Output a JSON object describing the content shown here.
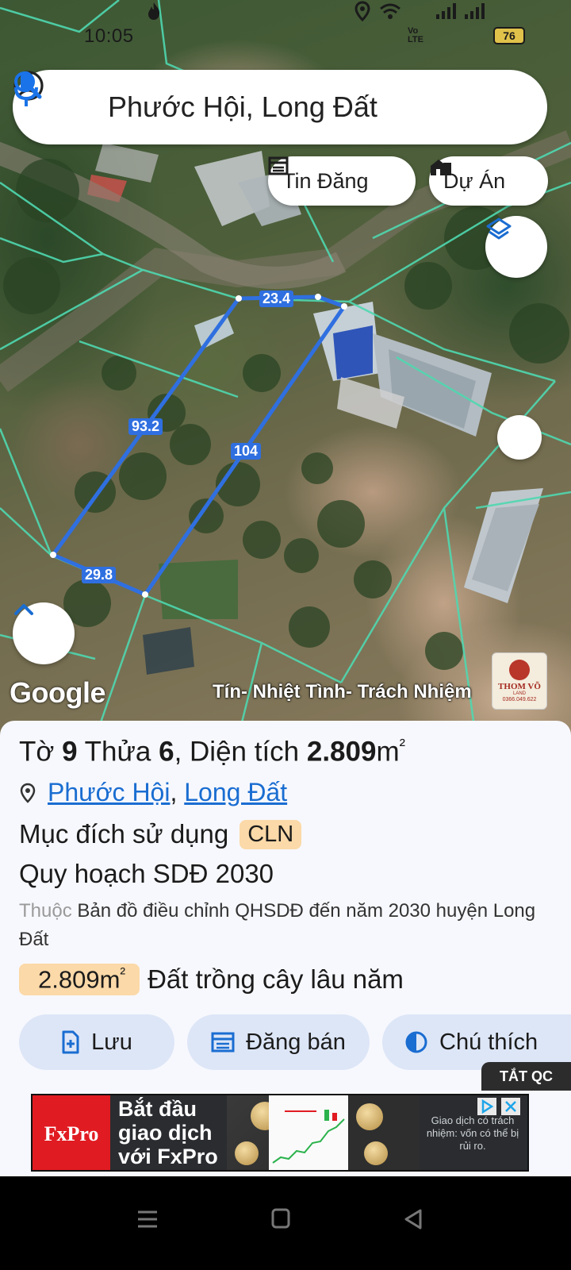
{
  "status_bar": {
    "time": "10:05",
    "battery": "76",
    "icons": [
      "flame-icon",
      "location-icon",
      "wifi-icon",
      "volte-icon",
      "signal-icon",
      "signal-icon",
      "battery-icon"
    ]
  },
  "search": {
    "query": "Phước Hội, Long Đất",
    "icons": [
      "account-icon",
      "search-icon",
      "mic-icon"
    ]
  },
  "chips": {
    "tin_dang": "Tin Đăng",
    "du_an": "Dự Án"
  },
  "map": {
    "edge_labels": [
      "23.4",
      "93.2",
      "104",
      "29.8"
    ],
    "google_logo": "Google",
    "watermark": "Tín- Nhiệt Tình- Trách Nhiệm",
    "brand": {
      "name_line1": "THOM VÕ",
      "name_line2": "LAND",
      "phone": "0366.049.622"
    },
    "parcel_outline_color": "#2f6fe0",
    "boundary_line_color": "#4fd8b0"
  },
  "parcel": {
    "title_prefix": "Tờ ",
    "sheet_no": "9",
    "title_mid": " Thửa ",
    "plot_no": "6",
    "title_area_label": ", Diện tích ",
    "area_value": "2.809",
    "area_unit": "m",
    "area_unit_sup": "²",
    "commune_link": "Phước Hội",
    "separator": ",",
    "district_link": "Long Đất",
    "purpose_label": "Mục đích sử dụng",
    "purpose_code": "CLN",
    "plan_title": "Quy hoạch SDĐ 2030",
    "plan_desc_muted": "Thuộc",
    "plan_desc": " Bản đồ điều chỉnh QHSDĐ đến năm 2030 huyện Long Đất",
    "land_area_badge": "2.809m",
    "land_area_sup": "²",
    "land_type": "Đất trồng cây lâu năm"
  },
  "actions": {
    "save": "Lưu",
    "post_sale": "Đăng bán",
    "legend": "Chú thích"
  },
  "ad": {
    "toggle_label": "TẮT QC",
    "brand": "FxPro",
    "headline": "Bắt đầu giao dịch với FxPro",
    "disclaimer": "Giao dịch có trách nhiệm: vốn có thể bị rủi ro."
  },
  "colors": {
    "accent_blue": "#1a6dd1",
    "badge_bg": "#fbd9a8",
    "button_bg": "#dde6f7",
    "fxpro_red": "#e11b22"
  }
}
